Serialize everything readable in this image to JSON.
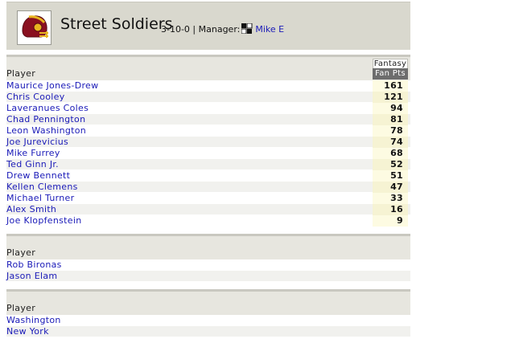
{
  "team": {
    "name": "Street Soldiers",
    "record": "3-10-0 | Manager:",
    "manager": "Mike E"
  },
  "starters": {
    "col_player": "Player",
    "col_group": "Fantasy",
    "col_pts": "Fan Pts",
    "rows": [
      {
        "player": "Maurice Jones-Drew",
        "pts": "161"
      },
      {
        "player": "Chris Cooley",
        "pts": "121"
      },
      {
        "player": "Laveranues Coles",
        "pts": "94"
      },
      {
        "player": "Chad Pennington",
        "pts": "81"
      },
      {
        "player": "Leon Washington",
        "pts": "78"
      },
      {
        "player": "Joe Jurevicius",
        "pts": "74"
      },
      {
        "player": "Mike Furrey",
        "pts": "68"
      },
      {
        "player": "Ted Ginn Jr.",
        "pts": "52"
      },
      {
        "player": "Drew Bennett",
        "pts": "51"
      },
      {
        "player": "Kellen Clemens",
        "pts": "47"
      },
      {
        "player": "Michael Turner",
        "pts": "33"
      },
      {
        "player": "Alex Smith",
        "pts": "16"
      },
      {
        "player": "Joe Klopfenstein",
        "pts": "9"
      }
    ]
  },
  "kickers": {
    "col_player": "Player",
    "rows": [
      {
        "player": "Rob Bironas"
      },
      {
        "player": "Jason Elam"
      }
    ]
  },
  "defenses": {
    "col_player": "Player",
    "rows": [
      {
        "player": "Washington"
      },
      {
        "player": "New York"
      }
    ]
  },
  "colors": {
    "link": "#1a1ab8",
    "header_bg": "#d9d8ce",
    "helmet": "#8a1020",
    "helmet_stripe": "#e8b520"
  }
}
